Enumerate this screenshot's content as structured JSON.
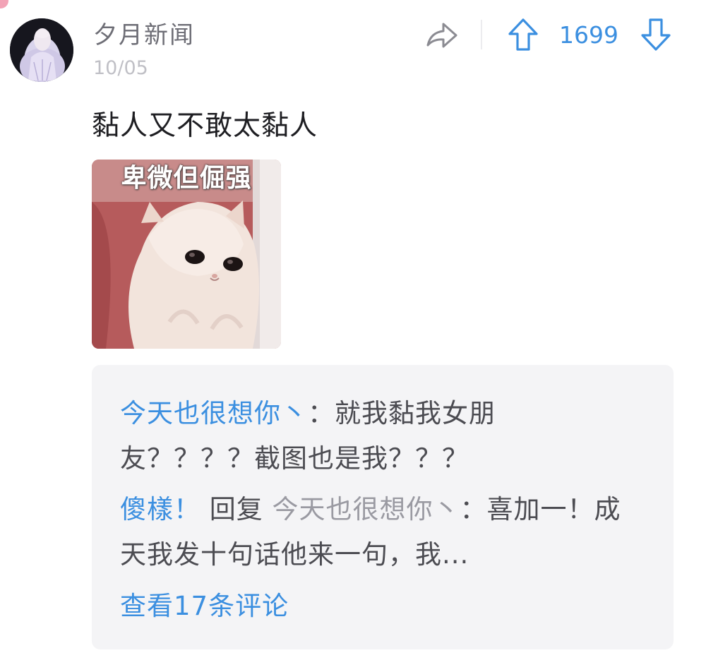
{
  "post": {
    "author": "夕月新闻",
    "date": "10/05",
    "text": "黏人又不敢太黏人",
    "vote_count": "1699",
    "image_caption": "卑微但倔强"
  },
  "icons": {
    "share": "share-arrow-icon",
    "upvote": "arrow-up-icon",
    "downvote": "arrow-down-icon"
  },
  "colors": {
    "accent": "#3b8fe0",
    "muted": "#9a9aa2",
    "comment_bg": "#f4f4f6"
  },
  "comments": [
    {
      "author": "今天也很想你丶",
      "separator": "：",
      "text": "就我黏我女朋友？？？？截图也是我？？？"
    },
    {
      "author": "傻樣！",
      "reply_word": " 回复 ",
      "reply_to": "今天也很想你丶",
      "separator": "：",
      "text": "喜加一！成天我发十句话他来一句，我..."
    }
  ],
  "view_more": "查看17条评论"
}
